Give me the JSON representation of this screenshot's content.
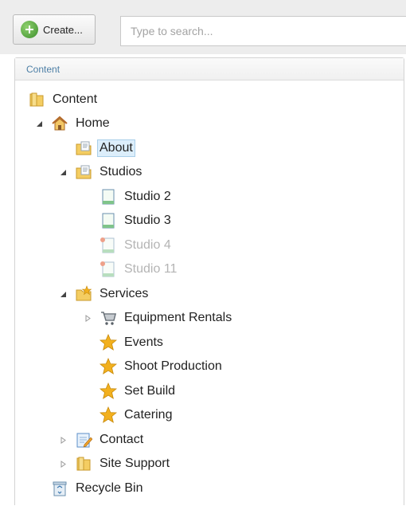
{
  "toolbar": {
    "create_label": "Create...",
    "search_placeholder": "Type to search..."
  },
  "panel": {
    "title": "Content"
  },
  "tree": [
    {
      "label": "Content",
      "icon": "folder-icon",
      "expander": "none",
      "state": "normal"
    },
    {
      "label": "Home",
      "icon": "home-icon",
      "expander": "expanded",
      "state": "normal"
    },
    {
      "label": "About",
      "icon": "document-folder-icon",
      "expander": "none",
      "state": "selected"
    },
    {
      "label": "Studios",
      "icon": "document-folder-icon",
      "expander": "expanded",
      "state": "normal"
    },
    {
      "label": "Studio 2",
      "icon": "page-icon",
      "expander": "none",
      "state": "normal"
    },
    {
      "label": "Studio 3",
      "icon": "page-icon",
      "expander": "none",
      "state": "normal"
    },
    {
      "label": "Studio 4",
      "icon": "unpublished-page-icon",
      "expander": "none",
      "state": "disabled"
    },
    {
      "label": "Studio 11",
      "icon": "unpublished-page-icon",
      "expander": "none",
      "state": "disabled"
    },
    {
      "label": "Services",
      "icon": "star-folder-icon",
      "expander": "expanded",
      "state": "normal"
    },
    {
      "label": "Equipment Rentals",
      "icon": "cart-icon",
      "expander": "collapsed",
      "state": "normal"
    },
    {
      "label": "Events",
      "icon": "star-icon",
      "expander": "none",
      "state": "normal"
    },
    {
      "label": "Shoot Production",
      "icon": "star-icon",
      "expander": "none",
      "state": "normal"
    },
    {
      "label": "Set Build",
      "icon": "star-icon",
      "expander": "none",
      "state": "normal"
    },
    {
      "label": "Catering",
      "icon": "star-icon",
      "expander": "none",
      "state": "normal"
    },
    {
      "label": "Contact",
      "icon": "form-icon",
      "expander": "collapsed",
      "state": "normal"
    },
    {
      "label": "Site Support",
      "icon": "folder-icon",
      "expander": "collapsed",
      "state": "normal"
    },
    {
      "label": "Recycle Bin",
      "icon": "recycle-bin-icon",
      "expander": "none",
      "state": "normal"
    }
  ],
  "colors": {
    "header_text": "#4d7fa6",
    "selected_bg": "#dceefb",
    "disabled_text": "#b4b4b4",
    "folder": "#e8b84a",
    "star": "#f2b01e"
  }
}
